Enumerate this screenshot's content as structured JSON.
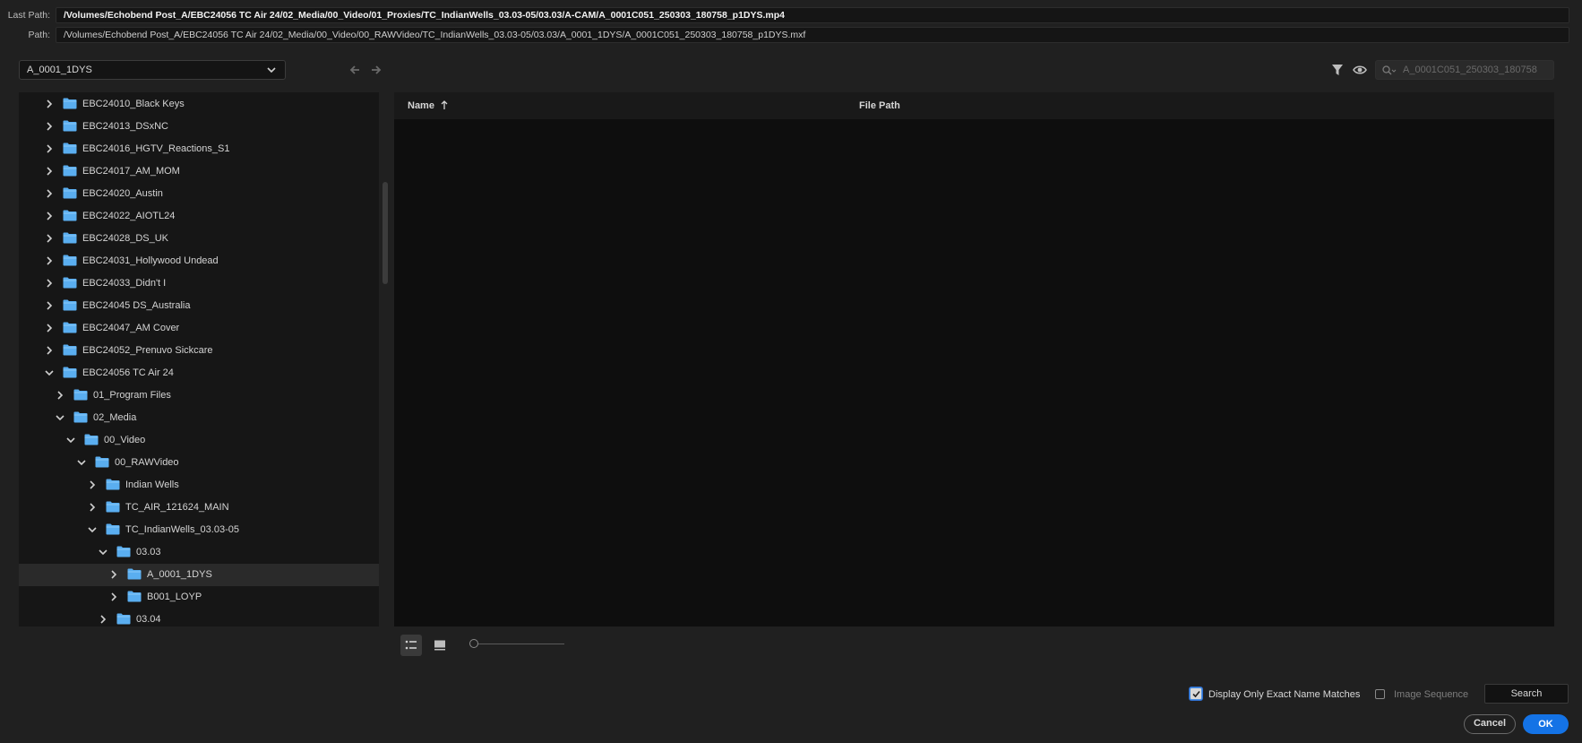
{
  "paths": {
    "last_path_label": "Last Path:",
    "last_path_value": "/Volumes/Echobend Post_A/EBC24056 TC Air 24/02_Media/00_Video/01_Proxies/TC_IndianWells_03.03-05/03.03/A-CAM/A_0001C051_250303_180758_p1DYS.mp4",
    "path_label": "Path:",
    "path_value": "/Volumes/Echobend Post_A/EBC24056 TC Air 24/02_Media/00_Video/00_RAWVideo/TC_IndianWells_03.03-05/03.03/A_0001_1DYS/A_0001C051_250303_180758_p1DYS.mxf"
  },
  "location_dropdown": {
    "selected": "A_0001_1DYS",
    "icon": "chevron-down-icon"
  },
  "search": {
    "placeholder": "A_0001C051_250303_180758",
    "icon": "search-icon"
  },
  "toolbar_icons": [
    "back-arrow-icon",
    "forward-arrow-icon",
    "filter-icon",
    "eye-icon"
  ],
  "tree": [
    {
      "label": "EBC24010_Black Keys",
      "depth": 0,
      "expanded": false
    },
    {
      "label": "EBC24013_DSxNC",
      "depth": 0,
      "expanded": false
    },
    {
      "label": "EBC24016_HGTV_Reactions_S1",
      "depth": 0,
      "expanded": false
    },
    {
      "label": "EBC24017_AM_MOM",
      "depth": 0,
      "expanded": false
    },
    {
      "label": "EBC24020_Austin",
      "depth": 0,
      "expanded": false
    },
    {
      "label": "EBC24022_AIOTL24",
      "depth": 0,
      "expanded": false
    },
    {
      "label": "EBC24028_DS_UK",
      "depth": 0,
      "expanded": false
    },
    {
      "label": "EBC24031_Hollywood Undead",
      "depth": 0,
      "expanded": false
    },
    {
      "label": "EBC24033_Didn't I",
      "depth": 0,
      "expanded": false
    },
    {
      "label": "EBC24045 DS_Australia",
      "depth": 0,
      "expanded": false
    },
    {
      "label": "EBC24047_AM Cover",
      "depth": 0,
      "expanded": false
    },
    {
      "label": "EBC24052_Prenuvo Sickcare",
      "depth": 0,
      "expanded": false
    },
    {
      "label": "EBC24056 TC Air 24",
      "depth": 0,
      "expanded": true
    },
    {
      "label": "01_Program Files",
      "depth": 1,
      "expanded": false
    },
    {
      "label": "02_Media",
      "depth": 1,
      "expanded": true
    },
    {
      "label": "00_Video",
      "depth": 2,
      "expanded": true
    },
    {
      "label": "00_RAWVideo",
      "depth": 3,
      "expanded": true
    },
    {
      "label": "Indian Wells",
      "depth": 4,
      "expanded": false
    },
    {
      "label": "TC_AIR_121624_MAIN",
      "depth": 4,
      "expanded": false
    },
    {
      "label": "TC_IndianWells_03.03-05",
      "depth": 4,
      "expanded": true
    },
    {
      "label": "03.03",
      "depth": 5,
      "expanded": true
    },
    {
      "label": "A_0001_1DYS",
      "depth": 6,
      "expanded": false,
      "selected": true
    },
    {
      "label": "B001_LOYP",
      "depth": 6,
      "expanded": false
    },
    {
      "label": "03.04",
      "depth": 5,
      "expanded": false
    }
  ],
  "file_list": {
    "columns": [
      {
        "label": "Name",
        "sort": "ascending"
      },
      {
        "label": "File Path"
      }
    ],
    "rows": []
  },
  "view_controls": {
    "list_view_active": true,
    "icons": [
      "list-view-icon",
      "thumbnail-view-icon"
    ],
    "zoom_level": 0
  },
  "options": {
    "exact_match_label": "Display Only Exact Name Matches",
    "exact_match_checked": true,
    "image_sequence_label": "Image Sequence",
    "image_sequence_checked": false,
    "image_sequence_enabled": false
  },
  "buttons": {
    "search": "Search",
    "cancel": "Cancel",
    "ok": "OK"
  },
  "colors": {
    "background": "#202020",
    "panel": "#161616",
    "list_bg": "#0e0e0e",
    "folder": "#5aaef0",
    "accent": "#1473e6"
  }
}
